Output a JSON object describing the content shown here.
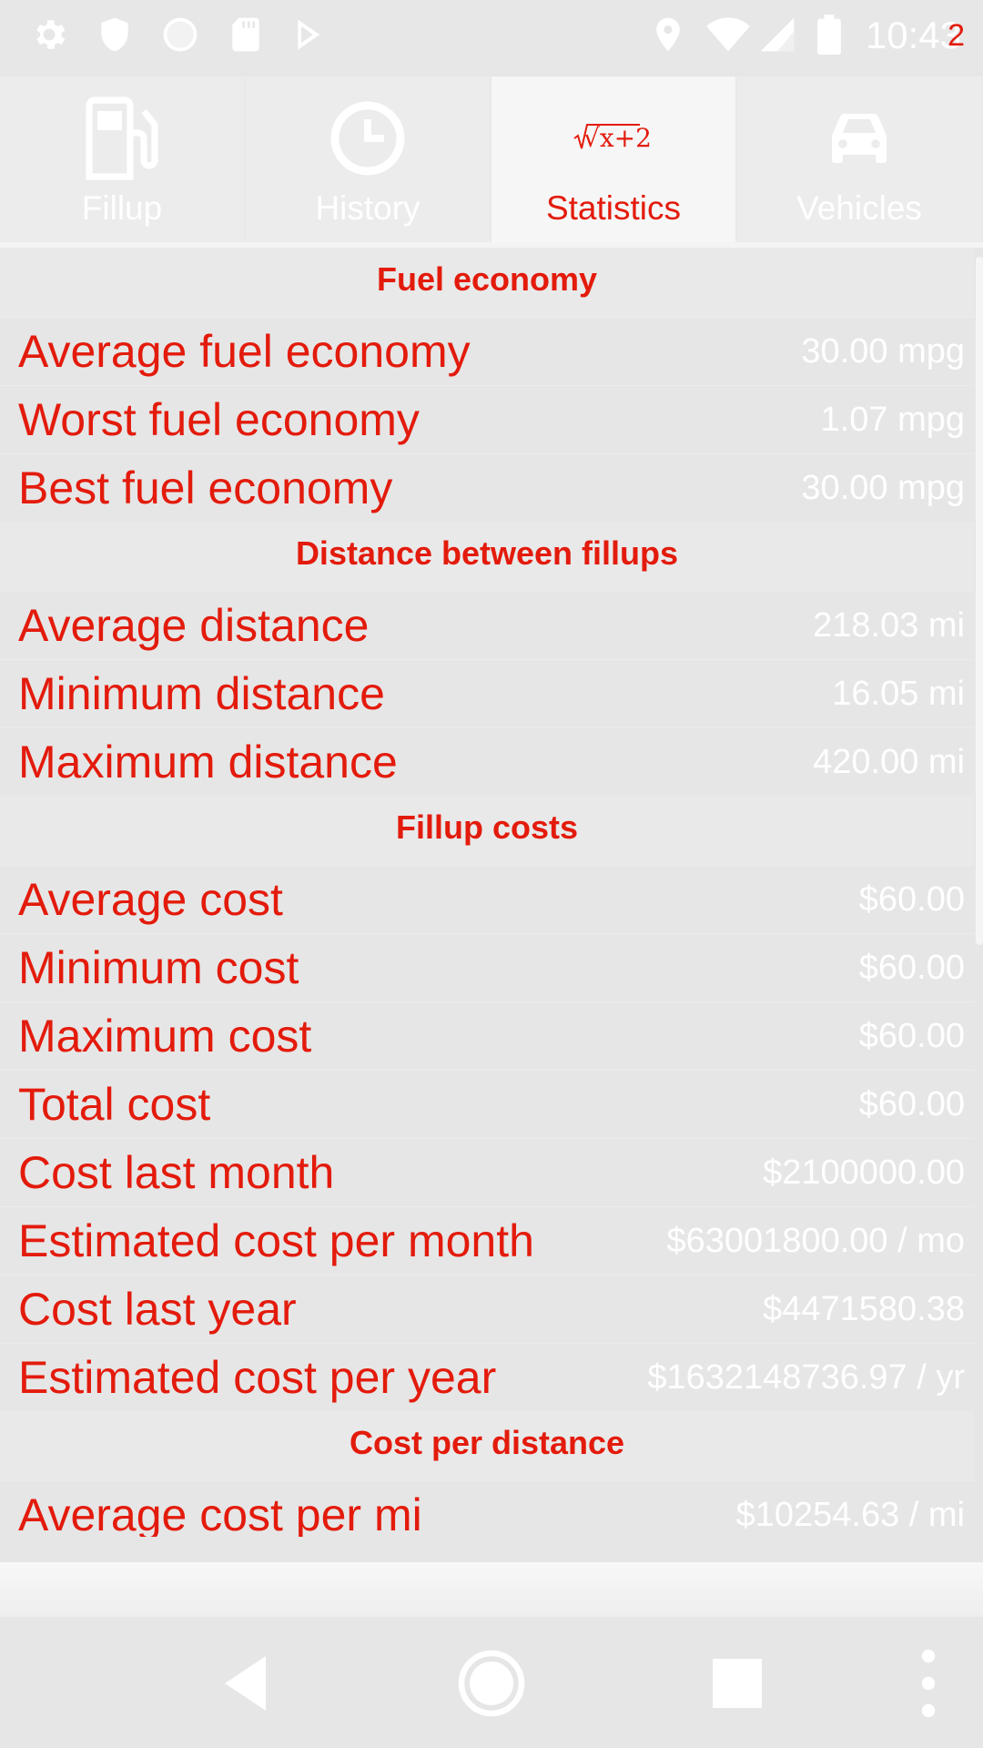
{
  "status_bar": {
    "time": "10:43",
    "time_overlap": "2",
    "left_icons": [
      "gear-icon",
      "shield-icon",
      "circle-icon",
      "sd-card-icon",
      "play-store-icon"
    ],
    "right_icons": [
      "location-icon",
      "wifi-icon",
      "signal-icon",
      "battery-icon"
    ]
  },
  "tabs": [
    {
      "label": "Fillup",
      "icon": "fuel-pump-icon",
      "active": false
    },
    {
      "label": "History",
      "icon": "clock-icon",
      "active": false
    },
    {
      "label": "Statistics",
      "icon": "math-formula-icon",
      "active": true,
      "icon_text": "√x+2"
    },
    {
      "label": "Vehicles",
      "icon": "car-icon",
      "active": false
    }
  ],
  "sections": [
    {
      "title": "Fuel economy",
      "rows": [
        {
          "label": "Average fuel economy",
          "value": "30.00 mpg"
        },
        {
          "label": "Worst fuel economy",
          "value": "1.07 mpg"
        },
        {
          "label": "Best fuel economy",
          "value": "30.00 mpg"
        }
      ]
    },
    {
      "title": "Distance between fillups",
      "rows": [
        {
          "label": "Average distance",
          "value": "218.03 mi"
        },
        {
          "label": "Minimum distance",
          "value": "16.05 mi"
        },
        {
          "label": "Maximum distance",
          "value": "420.00 mi"
        }
      ]
    },
    {
      "title": "Fillup costs",
      "rows": [
        {
          "label": "Average cost",
          "value": "$60.00"
        },
        {
          "label": "Minimum cost",
          "value": "$60.00"
        },
        {
          "label": "Maximum cost",
          "value": "$60.00"
        },
        {
          "label": "Total cost",
          "value": "$60.00"
        },
        {
          "label": "Cost last month",
          "value": "$2100000.00"
        },
        {
          "label": "Estimated cost per month",
          "value": "$63001800.00 / mo"
        },
        {
          "label": "Cost last year",
          "value": "$4471580.38"
        },
        {
          "label": "Estimated cost per year",
          "value": "$1632148736.97 / yr"
        }
      ]
    },
    {
      "title": "Cost per distance",
      "rows": [
        {
          "label": "Average cost per mi",
          "value": "$10254.63 / mi"
        }
      ]
    }
  ],
  "nav_bar": {
    "buttons": [
      "back-icon",
      "home-icon",
      "recents-icon",
      "overflow-menu-icon"
    ]
  },
  "colors": {
    "accent": "#e31b0c",
    "value_text": "#ffffff",
    "background": "#e6e6e6"
  }
}
